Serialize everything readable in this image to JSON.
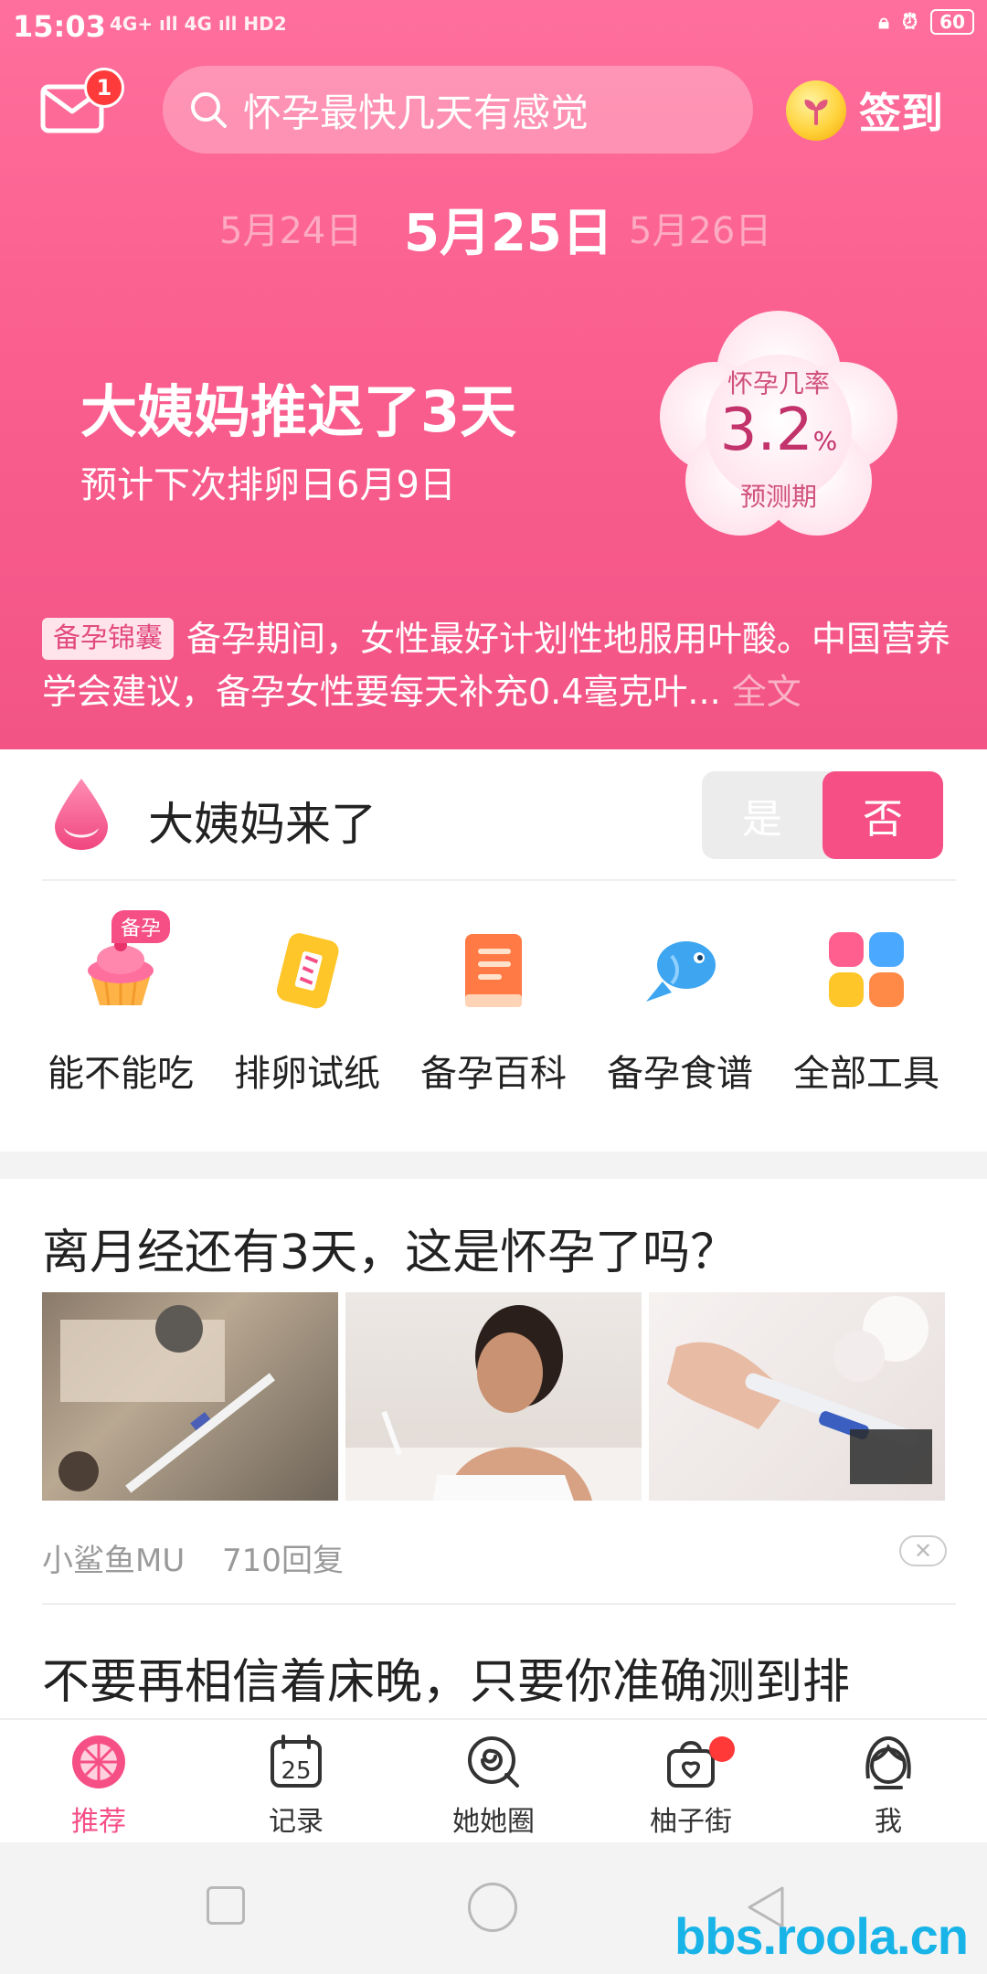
{
  "status": {
    "time": "15:03",
    "signal": "4G+ ıll 4G ıll HD2",
    "battery": "60"
  },
  "header": {
    "mail_badge": "1",
    "search_placeholder": "怀孕最快几天有感觉",
    "signin_label": "签到"
  },
  "dates": {
    "prev": "5月24日",
    "current": "5月25日",
    "next": "5月26日"
  },
  "cycle": {
    "delay_text": "大姨妈推迟了3天",
    "next_ovulation": "预计下次排卵日6月9日",
    "rate_label": "怀孕几率",
    "rate_value": "3.2",
    "rate_unit": "%",
    "phase": "预测期"
  },
  "tip": {
    "tag": "备孕锦囊",
    "text": "备孕期间，女性最好计划性地服用叶酸。中国营养学会建议，备孕女性要每天补充0.4毫克叶...",
    "more": "全文"
  },
  "period": {
    "title": "大姨妈来了",
    "yes": "是",
    "no": "否"
  },
  "tools": {
    "badge": "备孕",
    "items": [
      {
        "label": "能不能吃",
        "icon": "cupcake-icon"
      },
      {
        "label": "排卵试纸",
        "icon": "test-strip-icon"
      },
      {
        "label": "备孕百科",
        "icon": "book-icon"
      },
      {
        "label": "备孕食谱",
        "icon": "fish-icon"
      },
      {
        "label": "全部工具",
        "icon": "grid-icon"
      }
    ]
  },
  "feed": {
    "post1_title": "离月经还有3天，这是怀孕了吗？",
    "post1_author": "小鲨鱼MU",
    "post1_replies": "710回复",
    "post1_close": "✕",
    "post2_title": "不要再相信着床晚，只要你准确测到排"
  },
  "bottom_nav": [
    {
      "label": "推荐",
      "active": true
    },
    {
      "label": "记录",
      "date": "25"
    },
    {
      "label": "她她圈"
    },
    {
      "label": "柚子街",
      "dot": true
    },
    {
      "label": "我"
    }
  ],
  "watermark": "bbs.roola.cn",
  "colors": {
    "brand_pink": "#f64f86",
    "hero_top": "#ff6f9d",
    "hero_bottom": "#f25486"
  }
}
